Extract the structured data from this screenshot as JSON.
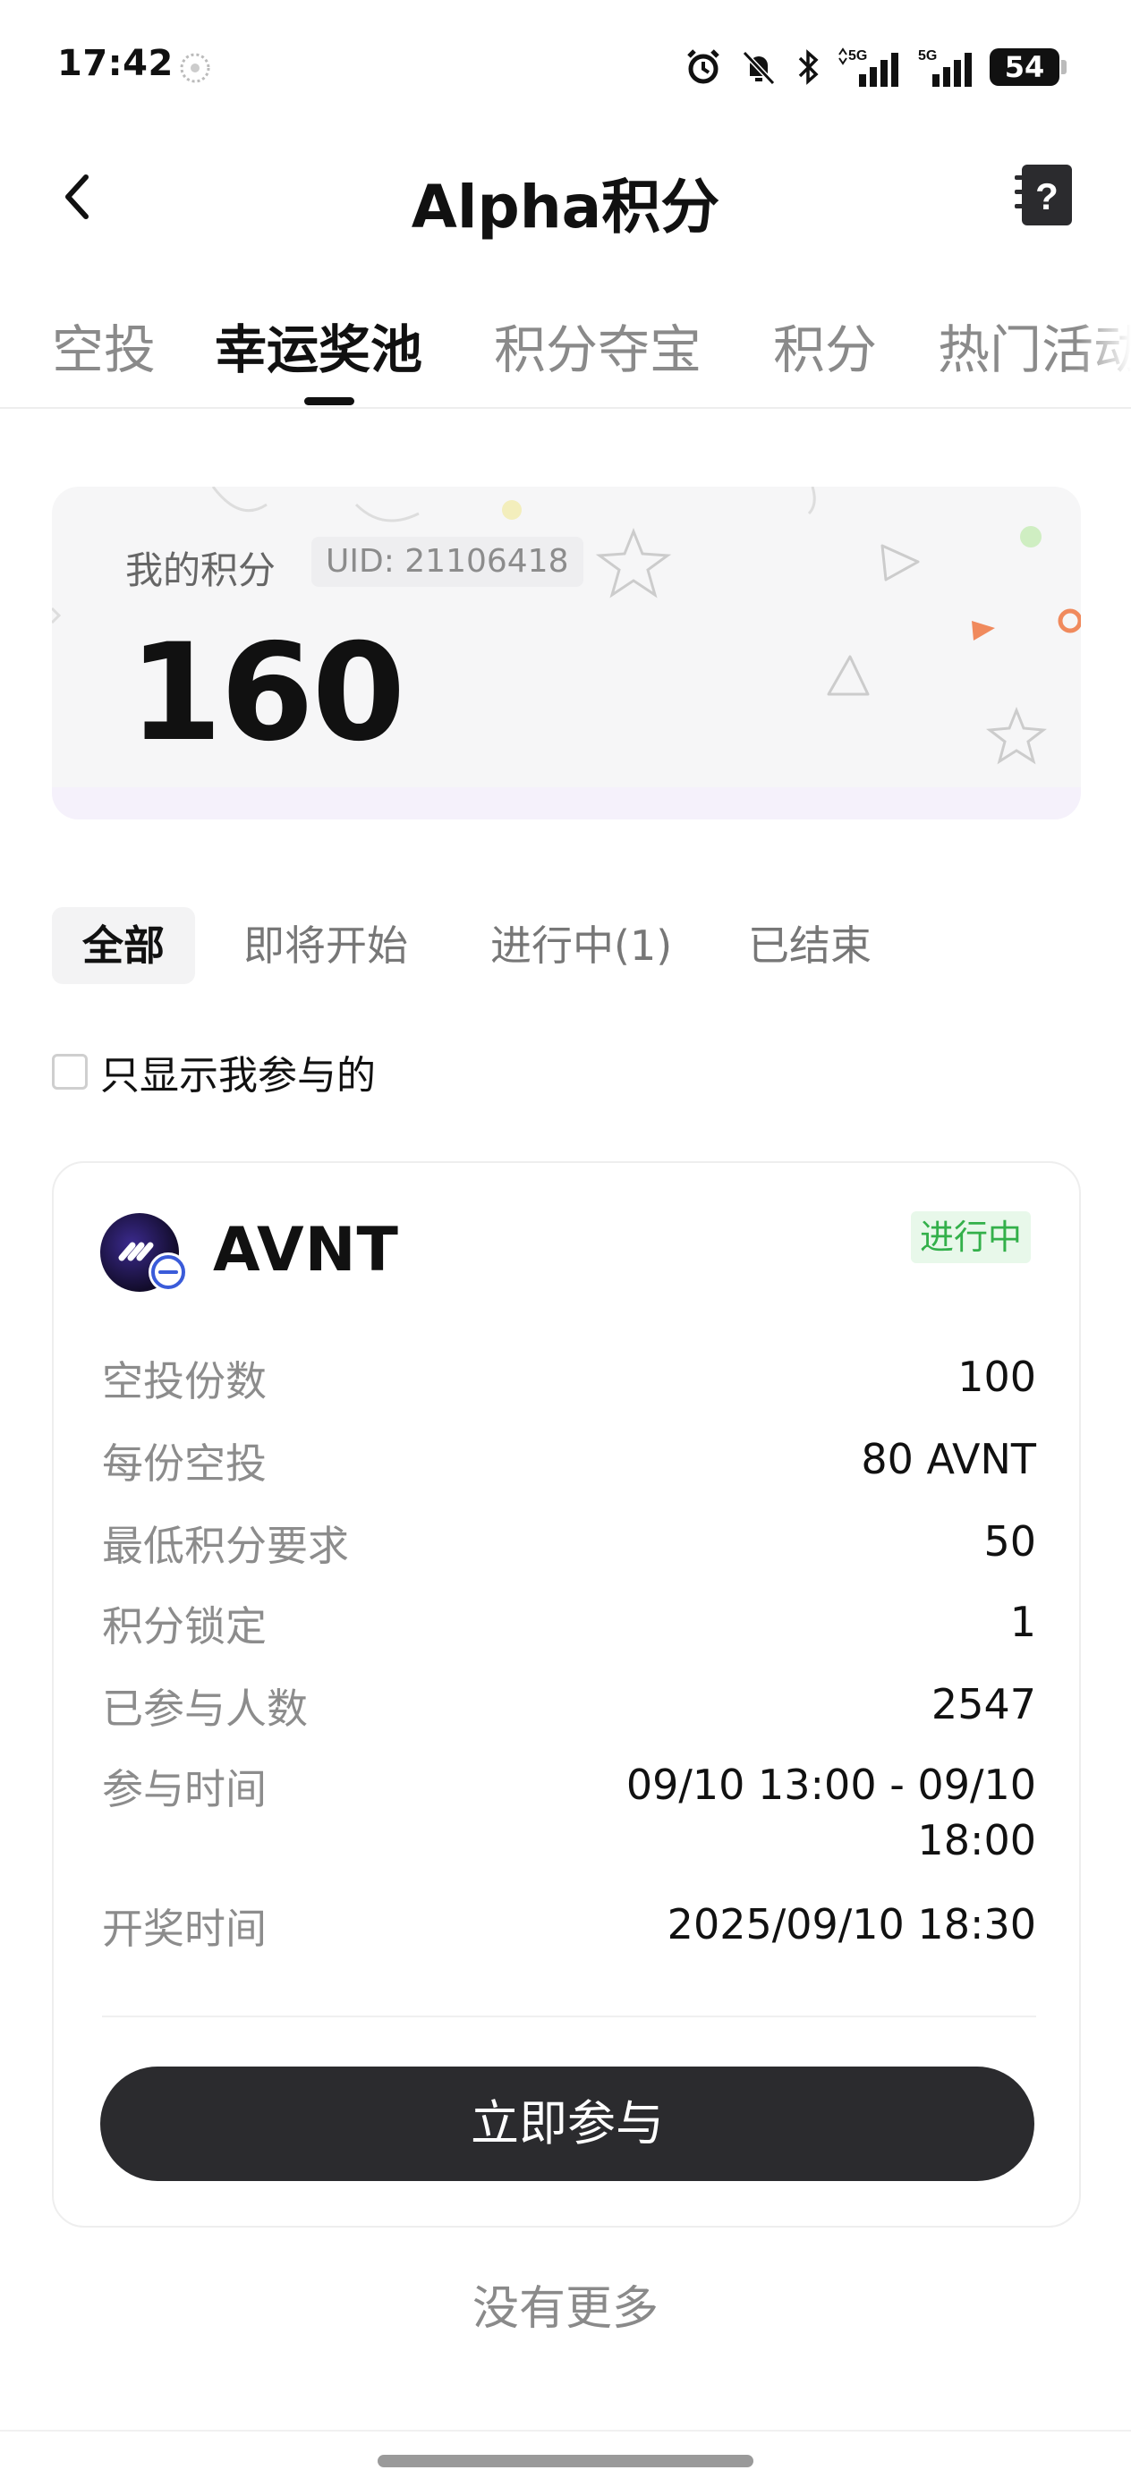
{
  "status_bar": {
    "time": "17:42",
    "battery": "54",
    "network_1": "5G",
    "network_2": "5G",
    "icons": [
      "alarm-icon",
      "mute-bell-icon",
      "bluetooth-icon",
      "signal-icon",
      "signal-icon",
      "battery-icon"
    ]
  },
  "header": {
    "title": "Alpha积分",
    "back_icon": "chevron-left-icon",
    "help_icon": "question-notebook-icon"
  },
  "tabs": [
    {
      "label": "空投",
      "active": false
    },
    {
      "label": "幸运奖池",
      "active": true
    },
    {
      "label": "积分夺宝",
      "active": false
    },
    {
      "label": "积分",
      "active": false
    },
    {
      "label": "热门活动",
      "active": false
    }
  ],
  "points": {
    "label": "我的积分",
    "uid": "UID: 21106418",
    "value": "160"
  },
  "filters": [
    {
      "label": "全部",
      "active": true
    },
    {
      "label": "即将开始",
      "active": false
    },
    {
      "label": "进行中(1)",
      "active": false
    },
    {
      "label": "已结束",
      "active": false
    }
  ],
  "only_mine": {
    "label": "只显示我参与的",
    "checked": false
  },
  "pool": {
    "token": "AVNT",
    "status": "进行中",
    "rows": [
      {
        "key": "空投份数",
        "value": "100"
      },
      {
        "key": "每份空投",
        "value": "80 AVNT"
      },
      {
        "key": "最低积分要求",
        "value": "50"
      },
      {
        "key": "积分锁定",
        "value": "1"
      },
      {
        "key": "已参与人数",
        "value": "2547"
      },
      {
        "key": "参与时间",
        "value": "09/10 13:00 - 09/10",
        "value_line2": "18:00"
      },
      {
        "key": "开奖时间",
        "value": "2025/09/10 18:30"
      }
    ],
    "join_button": "立即参与"
  },
  "footer": {
    "no_more": "没有更多"
  },
  "colors": {
    "status_green": "#33b04a",
    "status_bg": "#e8f8ea",
    "button_dark": "#2b2b2e",
    "muted_text": "#8c8c8c"
  }
}
